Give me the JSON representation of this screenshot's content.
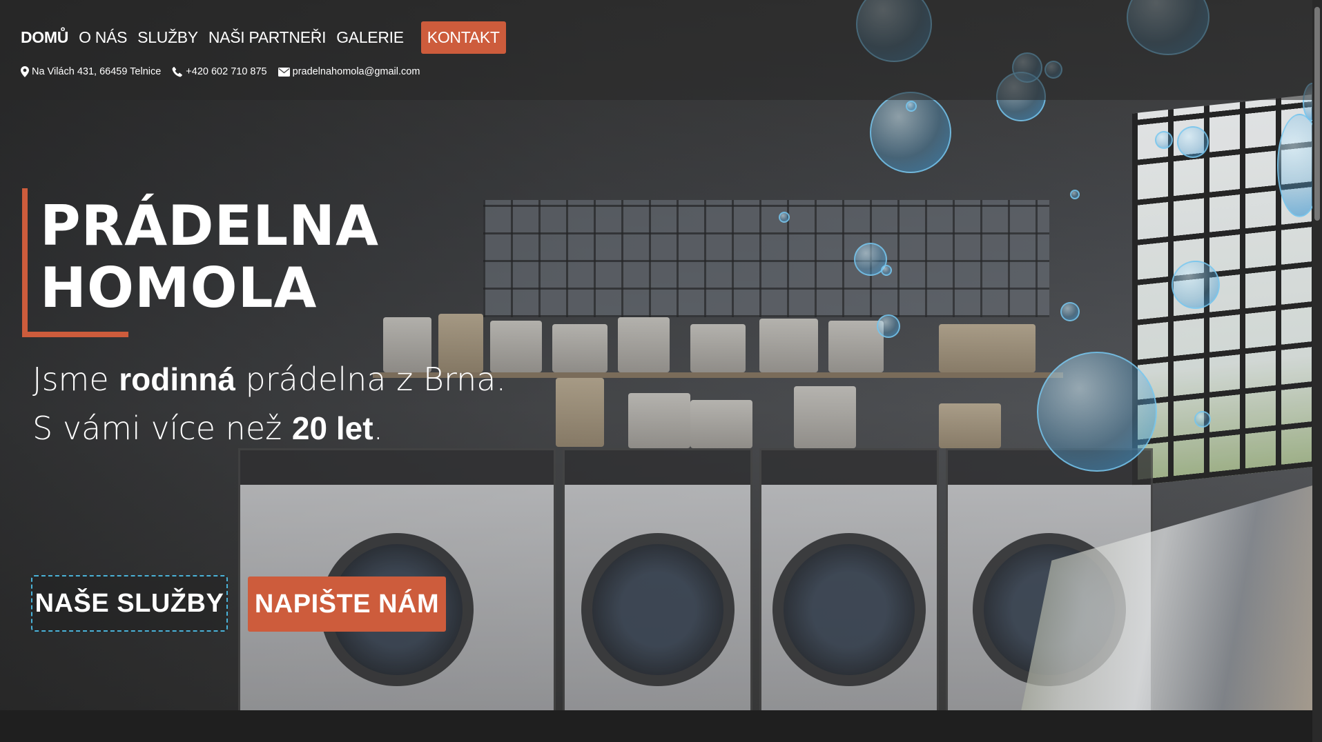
{
  "nav": {
    "items": [
      {
        "label": "DOMŮ",
        "active": true
      },
      {
        "label": "O NÁS",
        "active": false
      },
      {
        "label": "SLUŽBY",
        "active": false
      },
      {
        "label": "NAŠI PARTNEŘI",
        "active": false
      },
      {
        "label": "GALERIE",
        "active": false
      }
    ],
    "contact_label": "KONTAKT"
  },
  "contacts": {
    "address": "Na Vilách 431, 66459 Telnice",
    "phone": "+420 602 710 875",
    "email": "pradelnahomola@gmail.com",
    "icons": [
      "map-marker-icon",
      "phone-icon",
      "envelope-icon"
    ]
  },
  "hero": {
    "title_line1": "PRÁDELNA",
    "title_line2": "HOMOLA",
    "tagline": {
      "line1_pre": "Jsme ",
      "line1_bold": "rodinná",
      "line1_post": " prádelna z Brna.",
      "line2_pre": "S vámi více než ",
      "line2_bold": "20 let",
      "line2_post": "."
    },
    "services_button": "NAŠE SLUŽBY",
    "write_button": "NAPIŠTE NÁM"
  },
  "colors": {
    "accent": "#cd5c3c",
    "bubble": "#4ab3d9",
    "text": "#ffffff"
  }
}
